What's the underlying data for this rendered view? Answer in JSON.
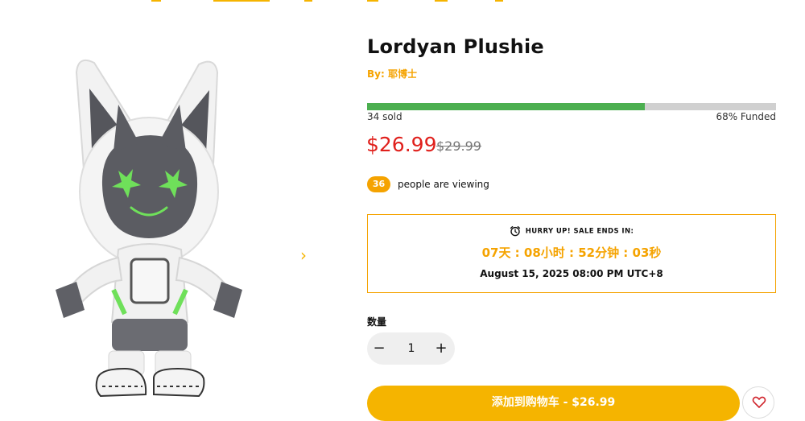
{
  "colors": {
    "accent": "#f5a300",
    "sale_price": "#e0201c",
    "progress_fill": "#4caf50"
  },
  "product": {
    "title": "Lordyan Plushie",
    "byline": "By: 耶博士",
    "image_icon": "plushie-image"
  },
  "funding": {
    "progress_fraction": 0.68,
    "sold_label": "34 sold",
    "funded_label": "68% Funded"
  },
  "pricing": {
    "current": "$26.99",
    "original": "$29.99"
  },
  "viewers": {
    "count": "36",
    "label": "people are viewing"
  },
  "sale": {
    "heading": "HURRY UP! SALE ENDS IN:",
    "countdown": "07天 : 08小时 : 52分钟 : 03秒",
    "end_date": "August 15, 2025 08:00 PM UTC+8",
    "icon": "alarm-clock-icon"
  },
  "quantity": {
    "label": "数量",
    "value": "1",
    "minus_icon": "minus-icon",
    "plus_icon": "plus-icon"
  },
  "cart": {
    "label": "添加到购物车 - $26.99"
  },
  "wishlist": {
    "icon": "heart-icon"
  },
  "gallery": {
    "next_icon": "chevron-right-icon"
  }
}
